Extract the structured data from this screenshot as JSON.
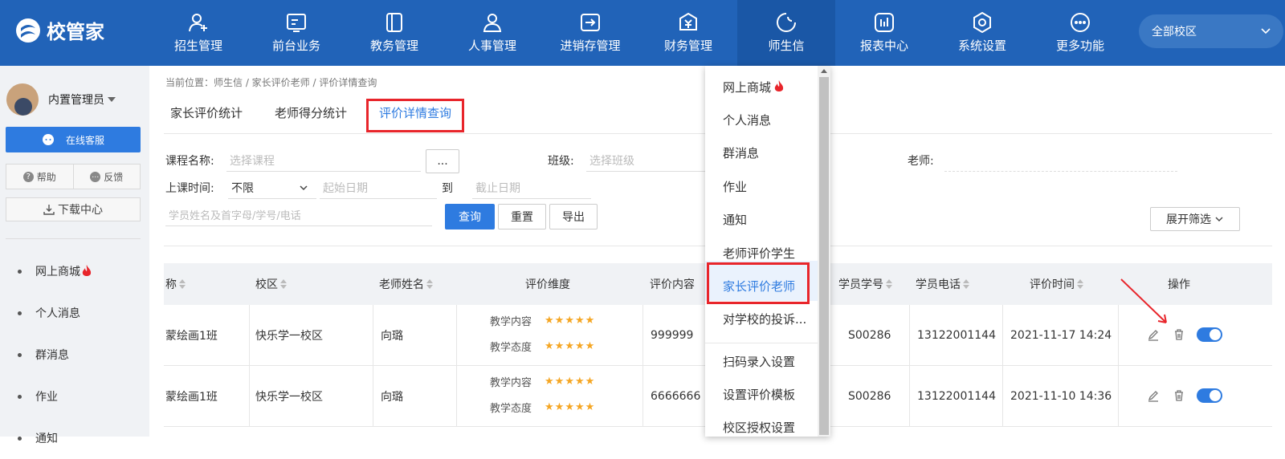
{
  "app": {
    "brand": "校管家",
    "campus": "全部校区"
  },
  "nav": [
    {
      "label": "招生管理",
      "icon": "user-plus-icon"
    },
    {
      "label": "前台业务",
      "icon": "desk-icon"
    },
    {
      "label": "教务管理",
      "icon": "book-icon"
    },
    {
      "label": "人事管理",
      "icon": "person-icon"
    },
    {
      "label": "进销存管理",
      "icon": "inventory-icon"
    },
    {
      "label": "财务管理",
      "icon": "finance-icon"
    },
    {
      "label": "师生信",
      "icon": "message-icon"
    },
    {
      "label": "报表中心",
      "icon": "report-icon"
    },
    {
      "label": "系统设置",
      "icon": "settings-icon"
    },
    {
      "label": "更多功能",
      "icon": "more-icon"
    }
  ],
  "sidebar": {
    "user": "内置管理员",
    "service": "在线客服",
    "help": "帮助",
    "feedback": "反馈",
    "download": "下载中心",
    "items": [
      "网上商城",
      "个人消息",
      "群消息",
      "作业",
      "通知"
    ]
  },
  "breadcrumb": "当前位置：师生信 / 家长评价老师 / 评价详情查询",
  "tabs": [
    "家长评价统计",
    "老师得分统计",
    "评价详情查询"
  ],
  "filters": {
    "course_label": "课程名称:",
    "course_placeholder": "选择课程",
    "ellipsis": "...",
    "class_label": "班级:",
    "class_placeholder": "选择班级",
    "teacher_label": "老师:",
    "time_label": "上课时间:",
    "time_select": "不限",
    "start_placeholder": "起始日期",
    "to": "到",
    "end_placeholder": "截止日期",
    "student_placeholder": "学员姓名及首字母/学号/电话",
    "query": "查询",
    "reset": "重置",
    "export": "导出",
    "expand": "展开筛选"
  },
  "table": {
    "headers": [
      "称",
      "校区",
      "老师姓名",
      "评价维度",
      "评价内容",
      "学员学号",
      "学员电话",
      "评价时间",
      "操作"
    ],
    "rows": [
      {
        "course": "蒙绘画1班",
        "campus": "快乐学一校区",
        "teacher": "向璐",
        "dim1": "教学内容",
        "dim2": "教学态度",
        "stars1": 5,
        "stars2": 5,
        "content": "999999",
        "student_no": "S00286",
        "phone": "13122001144",
        "time": "2021-11-17 14:24"
      },
      {
        "course": "蒙绘画1班",
        "campus": "快乐学一校区",
        "teacher": "向璐",
        "dim1": "教学内容",
        "dim2": "教学态度",
        "stars1": 5,
        "stars2": 5,
        "content": "6666666",
        "student_no": "S00286",
        "phone": "13122001144",
        "time": "2021-11-10 14:36"
      }
    ]
  },
  "dropdown": {
    "items": [
      "网上商城",
      "个人消息",
      "群消息",
      "作业",
      "通知",
      "老师评价学生",
      "家长评价老师",
      "对学校的投诉...",
      "扫码录入设置",
      "设置评价模板",
      "校区授权设置"
    ],
    "active": "家长评价老师"
  },
  "colors": {
    "topbar": "#2163b8",
    "accent": "#2e7be0",
    "highlight": "#e8252b",
    "star": "#f5a623"
  }
}
